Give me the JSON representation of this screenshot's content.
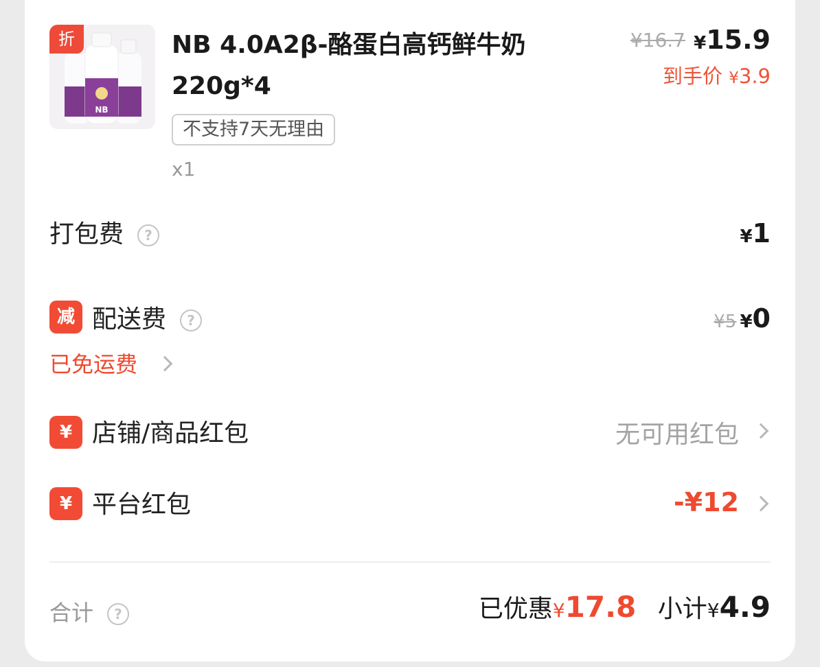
{
  "product": {
    "name_line1": "NB 4.0A2β-酪蛋白高钙鲜牛奶",
    "name_line2": "220g*4",
    "badge": "折",
    "return_tag": "不支持7天无理由",
    "quantity": "x1",
    "original_price": "¥16.7",
    "currency": "¥",
    "current_price": "15.9",
    "final_price_label": "到手价",
    "final_price": "3.9",
    "image_icon": "milk-bottles-image"
  },
  "packing_fee": {
    "label": "打包费",
    "help_icon": "?",
    "value": "1"
  },
  "delivery_fee": {
    "badge": "减",
    "label": "配送费",
    "help_icon": "?",
    "original": "¥5",
    "value": "0",
    "free_text": "已免运费"
  },
  "shop_coupon": {
    "badge": "¥",
    "label": "店铺/商品红包",
    "value": "无可用红包"
  },
  "platform_coupon": {
    "badge": "¥",
    "label": "平台红包",
    "value": "-¥12"
  },
  "total": {
    "label": "合计",
    "help_icon": "?",
    "discount_label": "已优惠",
    "discount_value": "17.8",
    "subtotal_label": "小计",
    "subtotal_value": "4.9"
  },
  "colors": {
    "accent_red": "#ee4a30",
    "badge_red": "#f24b35"
  }
}
